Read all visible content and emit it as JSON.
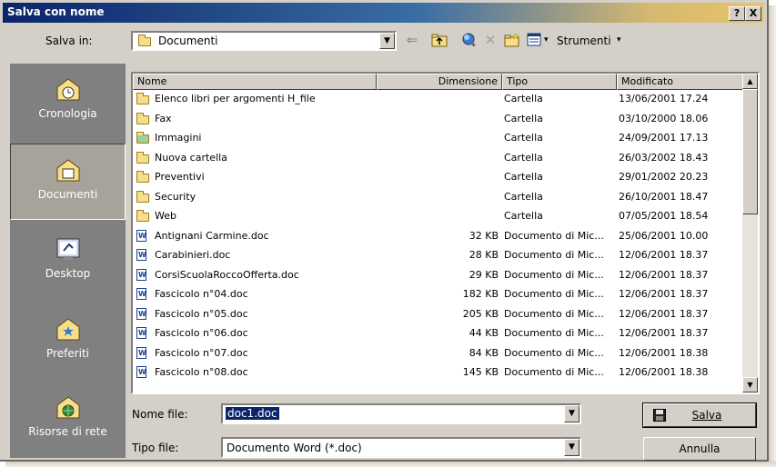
{
  "window": {
    "title": "Salva con nome",
    "help_label": "?",
    "close_label": "X"
  },
  "toolbar": {
    "save_in_label": "Salva in:",
    "location_value": "Documenti",
    "tools_label": "Strumenti"
  },
  "places": [
    {
      "label": "Cronologia",
      "icon": "history-icon"
    },
    {
      "label": "Documenti",
      "icon": "my-documents-icon"
    },
    {
      "label": "Desktop",
      "icon": "desktop-icon"
    },
    {
      "label": "Preferiti",
      "icon": "favorites-icon"
    },
    {
      "label": "Risorse di rete",
      "icon": "network-places-icon"
    }
  ],
  "columns": {
    "name": "Nome",
    "size": "Dimensione",
    "type": "Tipo",
    "modified": "Modificato"
  },
  "files": [
    {
      "name": "Elenco libri per argomenti H_file",
      "size": "",
      "type": "Cartella",
      "modified": "13/06/2001 17.24",
      "icon": "folder-icon"
    },
    {
      "name": "Fax",
      "size": "",
      "type": "Cartella",
      "modified": "03/10/2000 18.06",
      "icon": "folder-icon"
    },
    {
      "name": "Immagini",
      "size": "",
      "type": "Cartella",
      "modified": "24/09/2001 17.13",
      "icon": "pictures-folder-icon"
    },
    {
      "name": "Nuova cartella",
      "size": "",
      "type": "Cartella",
      "modified": "26/03/2002 18.43",
      "icon": "folder-icon"
    },
    {
      "name": "Preventivi",
      "size": "",
      "type": "Cartella",
      "modified": "29/01/2002 20.23",
      "icon": "folder-icon"
    },
    {
      "name": "Security",
      "size": "",
      "type": "Cartella",
      "modified": "26/10/2001 18.47",
      "icon": "folder-icon"
    },
    {
      "name": "Web",
      "size": "",
      "type": "Cartella",
      "modified": "07/05/2001 18.54",
      "icon": "folder-icon"
    },
    {
      "name": "Antignani Carmine.doc",
      "size": "32 KB",
      "type": "Documento di Mic...",
      "modified": "25/06/2001 10.00",
      "icon": "word-doc-icon"
    },
    {
      "name": "Carabinieri.doc",
      "size": "28 KB",
      "type": "Documento di Mic...",
      "modified": "12/06/2001 18.37",
      "icon": "word-doc-icon"
    },
    {
      "name": "CorsiScuolaRoccoOfferta.doc",
      "size": "29 KB",
      "type": "Documento di Mic...",
      "modified": "12/06/2001 18.37",
      "icon": "word-doc-icon"
    },
    {
      "name": "Fascicolo n°04.doc",
      "size": "182 KB",
      "type": "Documento di Mic...",
      "modified": "12/06/2001 18.37",
      "icon": "word-doc-icon"
    },
    {
      "name": "Fascicolo n°05.doc",
      "size": "205 KB",
      "type": "Documento di Mic...",
      "modified": "12/06/2001 18.37",
      "icon": "word-doc-icon"
    },
    {
      "name": "Fascicolo n°06.doc",
      "size": "44 KB",
      "type": "Documento di Mic...",
      "modified": "12/06/2001 18.37",
      "icon": "word-doc-icon"
    },
    {
      "name": "Fascicolo n°07.doc",
      "size": "84 KB",
      "type": "Documento di Mic...",
      "modified": "12/06/2001 18.38",
      "icon": "word-doc-icon"
    },
    {
      "name": "Fascicolo n°08.doc",
      "size": "145 KB",
      "type": "Documento di Mic...",
      "modified": "12/06/2001 18.38",
      "icon": "word-doc-icon"
    }
  ],
  "form": {
    "filename_label": "Nome file:",
    "filename_value": "doc1.doc",
    "filetype_label": "Tipo file:",
    "filetype_value": "Documento Word (*.doc)"
  },
  "buttons": {
    "save_label": "Salva",
    "cancel_label": "Annulla"
  }
}
